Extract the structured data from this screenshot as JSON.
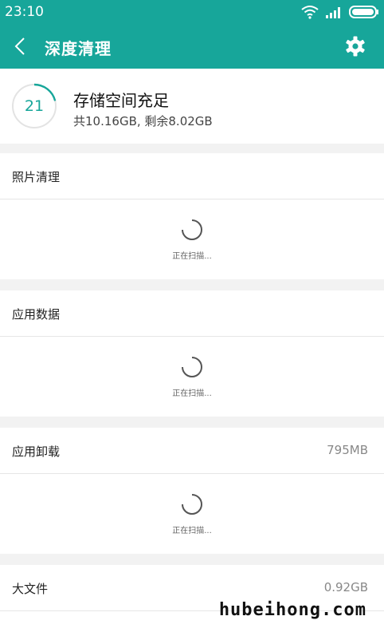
{
  "status": {
    "time": "23:10"
  },
  "header": {
    "title": "深度清理"
  },
  "storage": {
    "score": "21",
    "score_fraction": 0.21,
    "title": "存储空间充足",
    "subtitle": "共10.16GB, 剩余8.02GB"
  },
  "sections": [
    {
      "title": "照片清理",
      "size": "",
      "scan_text": "正在扫描..."
    },
    {
      "title": "应用数据",
      "size": "",
      "scan_text": "正在扫描..."
    },
    {
      "title": "应用卸载",
      "size": "795MB",
      "scan_text": "正在扫描..."
    },
    {
      "title": "大文件",
      "size": "0.92GB"
    }
  ],
  "watermark": "hubeihong.com",
  "colors": {
    "accent": "#17a69a",
    "background": "#f2f2f2"
  },
  "icons": [
    "wifi-icon",
    "signal-icon",
    "battery-icon",
    "back-arrow-icon",
    "gear-icon",
    "spinner-icon"
  ]
}
